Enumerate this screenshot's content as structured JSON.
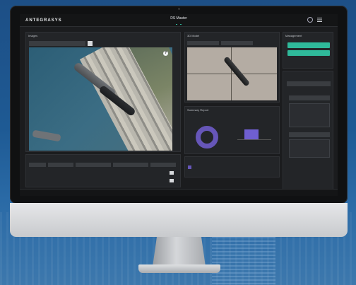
{
  "header": {
    "logo": "ANTEGRASYS",
    "title": "DS Master",
    "tabs": [
      "",
      ""
    ],
    "user_name": "",
    "user_sub": ""
  },
  "images_panel": {
    "title": "Images",
    "dropdown": "",
    "overlay_label": "",
    "zoom": ""
  },
  "details": {
    "title": "",
    "columns": [
      "",
      "",
      "",
      "",
      ""
    ],
    "rows": [
      {
        "a": "",
        "b": "",
        "c": "",
        "d": ""
      },
      {
        "a": "",
        "b": "",
        "c": "",
        "d": ""
      }
    ]
  },
  "model_panel": {
    "title": "3D Model",
    "dropdown1": "",
    "dropdown2": ""
  },
  "summary": {
    "title": "Summary Report",
    "label1": "",
    "label2": ""
  },
  "annotations": {
    "title": "",
    "item": "",
    "item_right": ""
  },
  "management": {
    "title": "Management",
    "btn1": "",
    "btn2": ""
  },
  "filters": {
    "title": "",
    "dd1": "",
    "dd2": "",
    "dd3": "",
    "card1_lines": [
      "",
      "",
      ""
    ],
    "card2_lines": [
      "",
      "",
      ""
    ]
  },
  "status": {
    "left": "",
    "right": ""
  },
  "colors": {
    "accent": "#2fb99a",
    "chart_purple": "#6656b8"
  }
}
